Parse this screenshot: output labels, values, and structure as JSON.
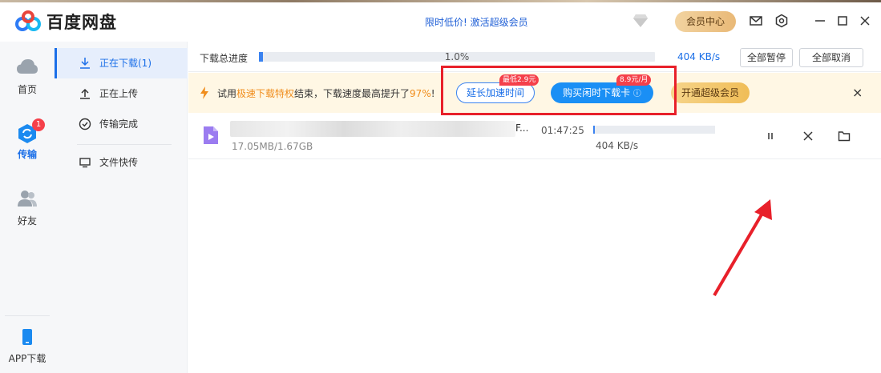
{
  "app": {
    "title": "百度网盘"
  },
  "header": {
    "promo_part1": "限时低价!",
    "promo_part2": "激活超级会员",
    "vip_center": "会员中心"
  },
  "rail": {
    "items": [
      {
        "label": "首页"
      },
      {
        "label": "传输",
        "badge": "1"
      },
      {
        "label": "好友"
      }
    ],
    "bottom": {
      "label": "APP下载"
    }
  },
  "subnav": {
    "items": [
      {
        "label": "正在下载(1)"
      },
      {
        "label": "正在上传"
      },
      {
        "label": "传输完成"
      },
      {
        "label": "文件快传"
      }
    ]
  },
  "progress": {
    "label": "下载总进度",
    "percent_text": "1.0%",
    "percent": 1.0,
    "speed": "404 KB/s",
    "pause_all": "全部暂停",
    "cancel_all": "全部取消"
  },
  "banner": {
    "text_1": "试用",
    "text_hl_1": "极速下载特权",
    "text_2": "结束，下载速度最高提升了",
    "text_hl_2": "97%",
    "text_3": "!",
    "extend_label": "延长加速时间",
    "extend_tag": "最低2.9元",
    "buy_label": "购买闲时下载卡",
    "buy_info": "ⓘ",
    "buy_tag": "8.9元/月",
    "vip_label": "开通超级会员",
    "close": "×"
  },
  "file": {
    "name_tail": "F...",
    "size": "17.05MB/1.67GB",
    "time_left": "01:47:25",
    "speed": "404 KB/s",
    "progress": 1.0
  },
  "colors": {
    "accent": "#1b6fe8",
    "highlight": "#f08d1c",
    "annotation": "#e8202a"
  }
}
